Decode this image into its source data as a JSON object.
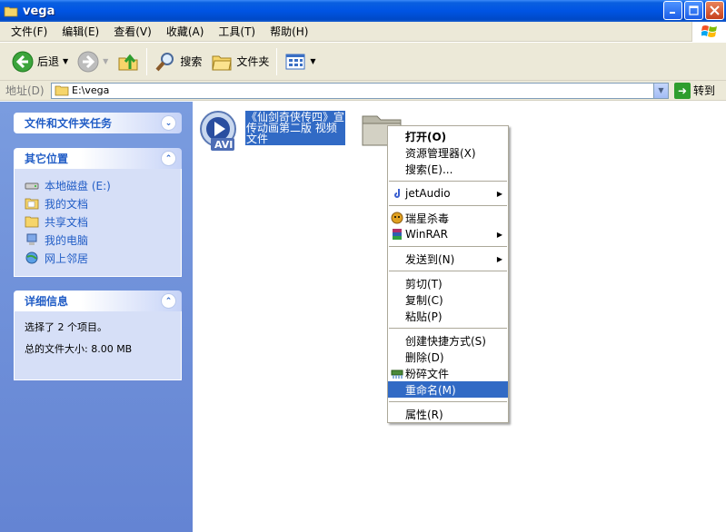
{
  "window": {
    "title": "vega"
  },
  "menu": [
    "文件(F)",
    "编辑(E)",
    "查看(V)",
    "收藏(A)",
    "工具(T)",
    "帮助(H)"
  ],
  "toolbar": {
    "back": "后退",
    "search": "搜索",
    "folders": "文件夹"
  },
  "address": {
    "label": "地址(D)",
    "value": "E:\\vega",
    "go": "转到"
  },
  "left": {
    "tasks_title": "文件和文件夹任务",
    "places_title": "其它位置",
    "places": [
      "本地磁盘 (E:)",
      "我的文档",
      "共享文档",
      "我的电脑",
      "网上邻居"
    ],
    "details_title": "详细信息",
    "details_selected": "选择了 2 个项目。",
    "details_size": "总的文件大小: 8.00 MB"
  },
  "files": [
    {
      "name": "《仙剑奇侠传四》宣传动画第二版 视频文件",
      "badge": "AVI"
    },
    {
      "name": ""
    }
  ],
  "context_menu": {
    "open": "打开(O)",
    "explorer": "资源管理器(X)",
    "search": "搜索(E)...",
    "jetaudio": "jetAudio",
    "rising": "瑞星杀毒",
    "winrar": "WinRAR",
    "sendto": "发送到(N)",
    "cut": "剪切(T)",
    "copy": "复制(C)",
    "paste": "粘贴(P)",
    "shortcut": "创建快捷方式(S)",
    "delete": "删除(D)",
    "shred": "粉碎文件",
    "rename": "重命名(M)",
    "properties": "属性(R)"
  },
  "colors": {
    "titlebar": "#0054e3",
    "selection": "#316ac5",
    "leftpane": "#7a9cdf",
    "link": "#215dc6"
  }
}
